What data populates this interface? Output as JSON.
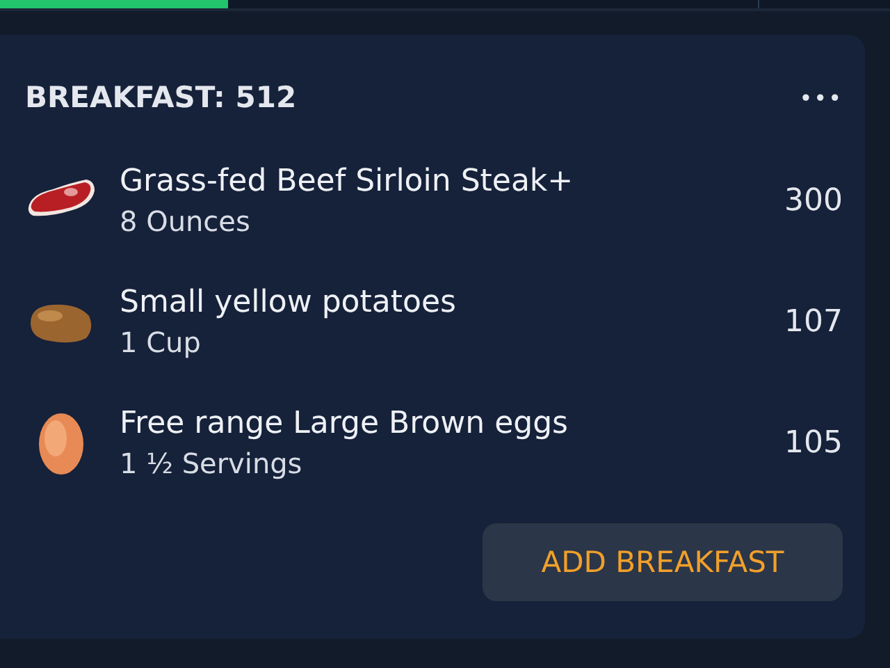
{
  "progress": {
    "level": 0.3
  },
  "meal": {
    "title": "BREAKFAST: 512",
    "menu": "•••",
    "items": [
      {
        "name": "Grass-fed Beef Sirloin Steak+",
        "amount": "8 Ounces",
        "calories": "300"
      },
      {
        "name": "Small yellow potatoes",
        "amount": "1 Cup",
        "calories": "107"
      },
      {
        "name": "Free range Large Brown eggs",
        "amount": "1 ½ Servings",
        "calories": "105"
      }
    ],
    "button": "ADD BREAKFAST"
  }
}
